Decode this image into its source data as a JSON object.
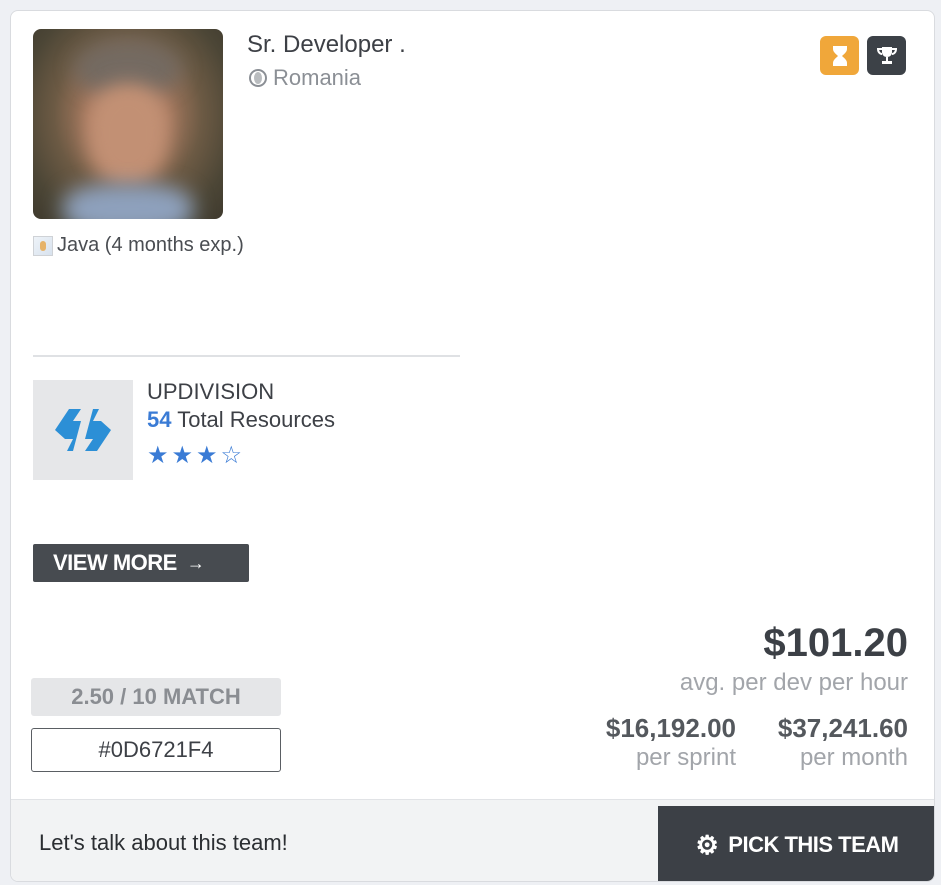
{
  "profile": {
    "title": "Sr. Developer .",
    "country": "Romania",
    "skill": "Java (4 months exp.)",
    "avatar_icon": "developer-photo",
    "badges": [
      {
        "icon": "hourglass-icon",
        "color": "#f0a73a"
      },
      {
        "icon": "trophy-icon",
        "color": "#3c4147"
      }
    ]
  },
  "company": {
    "name": "UPDIVISION",
    "resources_count": "54",
    "resources_label": "Total Resources",
    "rating": 3,
    "rating_max": 5,
    "stars_text": "★★★☆",
    "logo_color": "#2c8fd6"
  },
  "actions": {
    "view_more_label": "VIEW MORE",
    "view_more_arrow": "→",
    "pick_label": "PICK THIS TEAM",
    "talk_label": "Let's talk about this team!"
  },
  "match": {
    "score_label": "2.50 / 10 MATCH",
    "code": "#0D6721F4"
  },
  "pricing": {
    "avg": "$101.20",
    "avg_label": "avg. per dev per hour",
    "sprint": "$16,192.00",
    "sprint_label": "per sprint",
    "month": "$37,241.60",
    "month_label": "per month"
  },
  "colors": {
    "accent_blue": "#3a7bd5",
    "dark": "#3c4046",
    "orange": "#f0a73a"
  }
}
